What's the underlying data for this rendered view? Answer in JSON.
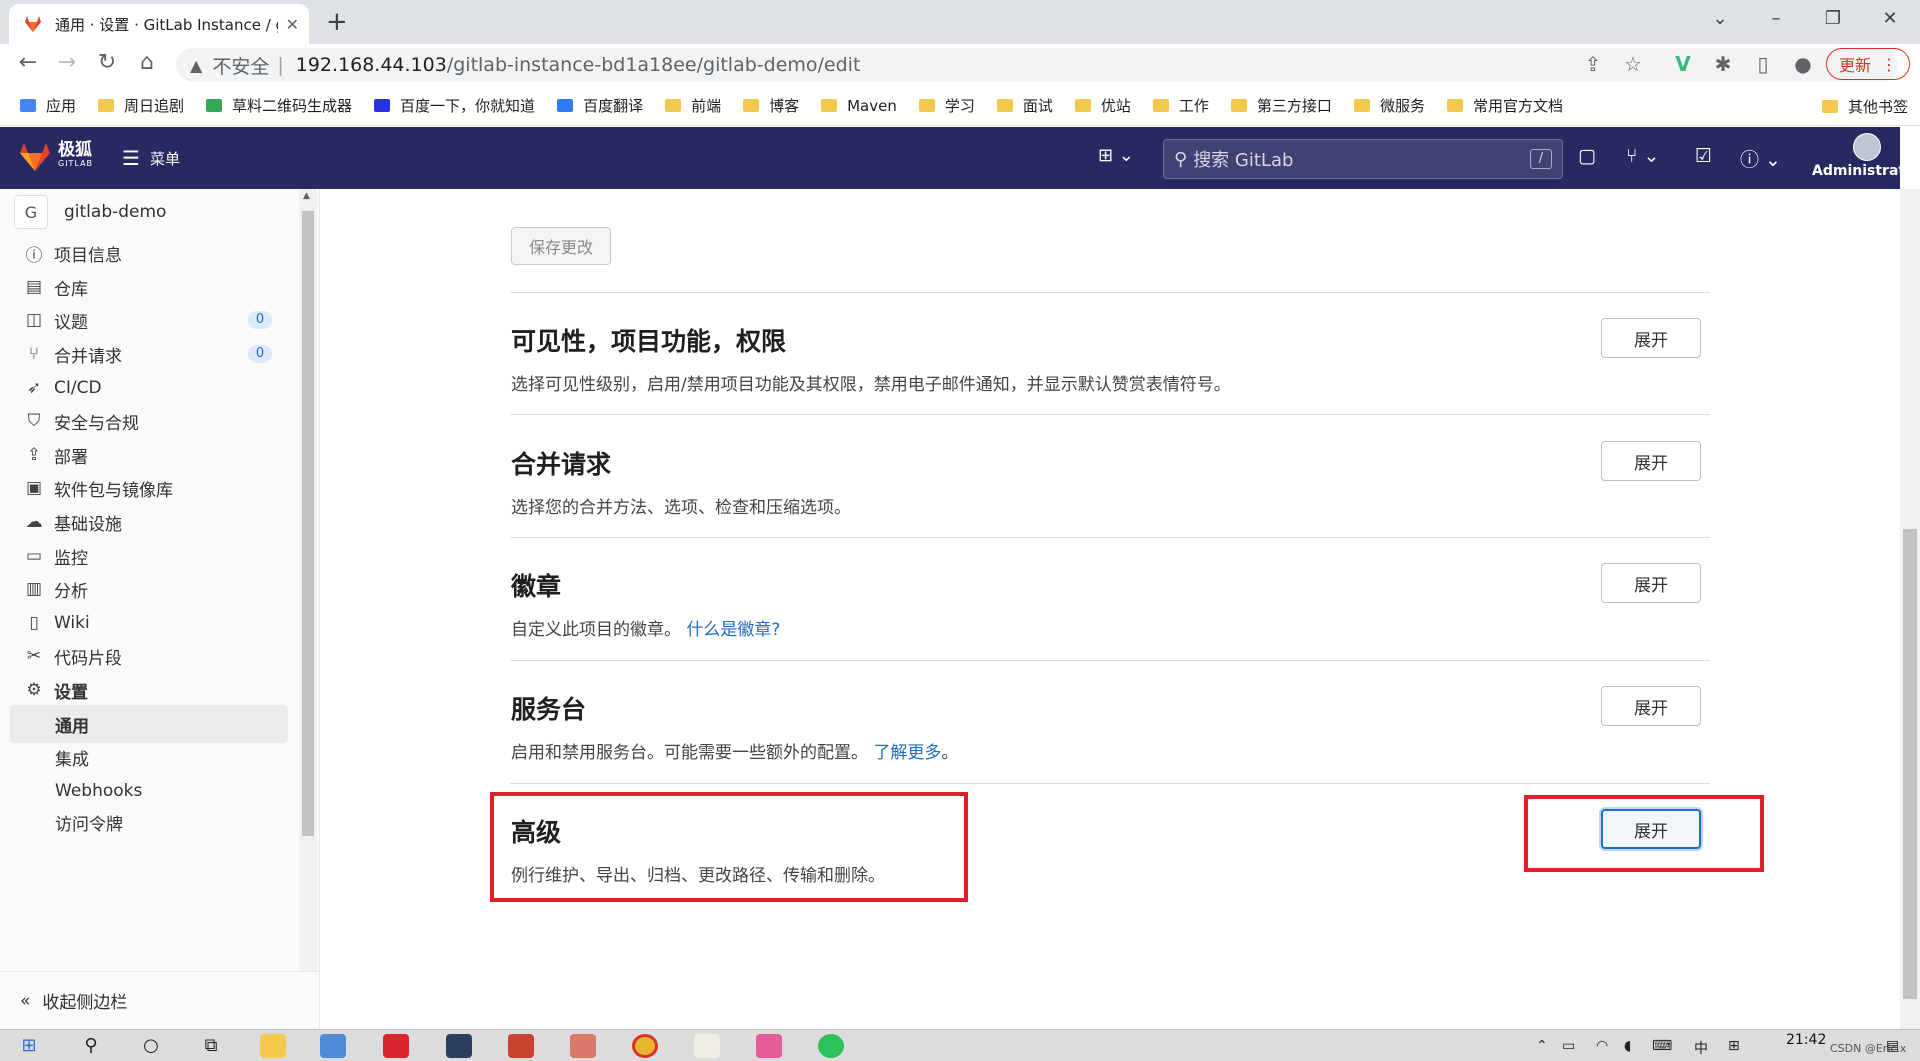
{
  "browser": {
    "tab_title": "通用 · 设置 · GitLab Instance / g",
    "tab_close": "✕",
    "new_tab": "+",
    "address_warning": "不安全",
    "address_host": "192.168.44.103",
    "address_path": "/gitlab-instance-bd1a18ee/gitlab-demo/edit",
    "update_label": "更新"
  },
  "bookmarks": [
    {
      "label": "应用",
      "icon": "apps-grid-icon"
    },
    {
      "label": "周日追剧",
      "icon": "folder-icon"
    },
    {
      "label": "草料二维码生成器",
      "icon": "qr-icon"
    },
    {
      "label": "百度一下，你就知道",
      "icon": "baidu-icon"
    },
    {
      "label": "百度翻译",
      "icon": "translate-icon"
    },
    {
      "label": "前端",
      "icon": "folder-icon"
    },
    {
      "label": "博客",
      "icon": "folder-icon"
    },
    {
      "label": "Maven",
      "icon": "folder-icon"
    },
    {
      "label": "学习",
      "icon": "folder-icon"
    },
    {
      "label": "面试",
      "icon": "folder-icon"
    },
    {
      "label": "优站",
      "icon": "folder-icon"
    },
    {
      "label": "工作",
      "icon": "folder-icon"
    },
    {
      "label": "第三方接口",
      "icon": "folder-icon"
    },
    {
      "label": "微服务",
      "icon": "folder-icon"
    },
    {
      "label": "常用官方文档",
      "icon": "folder-icon"
    }
  ],
  "bookmarks_other": "其他书签",
  "gitlab": {
    "brand_main": "极狐",
    "brand_sub": "GITLAB",
    "menu_label": "菜单",
    "search_placeholder": "搜索 GitLab",
    "search_shortcut": "/",
    "user_name": "Administrator"
  },
  "sidebar": {
    "project_initial": "G",
    "project_name": "gitlab-demo",
    "items": [
      {
        "label": "项目信息",
        "icon": "info-icon"
      },
      {
        "label": "仓库",
        "icon": "document-icon"
      },
      {
        "label": "议题",
        "icon": "issues-icon",
        "badge": "0"
      },
      {
        "label": "合并请求",
        "icon": "merge-request-icon",
        "badge": "0"
      },
      {
        "label": "CI/CD",
        "icon": "rocket-icon"
      },
      {
        "label": "安全与合规",
        "icon": "shield-icon"
      },
      {
        "label": "部署",
        "icon": "deploy-icon"
      },
      {
        "label": "软件包与镜像库",
        "icon": "package-icon"
      },
      {
        "label": "基础设施",
        "icon": "cloud-icon"
      },
      {
        "label": "监控",
        "icon": "monitor-icon"
      },
      {
        "label": "分析",
        "icon": "chart-icon"
      },
      {
        "label": "Wiki",
        "icon": "book-icon"
      },
      {
        "label": "代码片段",
        "icon": "scissors-icon"
      },
      {
        "label": "设置",
        "icon": "settings-icon"
      }
    ],
    "sub_items": [
      {
        "label": "通用",
        "active": true
      },
      {
        "label": "集成"
      },
      {
        "label": "Webhooks"
      },
      {
        "label": "访问令牌"
      }
    ],
    "collapse_label": "收起侧边栏"
  },
  "main": {
    "save_button": "保存更改",
    "expand_label": "展开",
    "sections": [
      {
        "title": "可见性，项目功能，权限",
        "desc": "选择可见性级别，启用/禁用项目功能及其权限，禁用电子邮件通知，并显示默认赞赏表情符号。"
      },
      {
        "title": "合并请求",
        "desc": "选择您的合并方法、选项、检查和压缩选项。"
      },
      {
        "title": "徽章",
        "desc": "自定义此项目的徽章。",
        "link": "什么是徽章?"
      },
      {
        "title": "服务台",
        "desc": "启用和禁用服务台。可能需要一些额外的配置。",
        "link": "了解更多",
        "suffix": "。"
      },
      {
        "title": "高级",
        "desc": "例行维护、导出、归档、更改路径、传输和删除。"
      }
    ]
  },
  "taskbar": {
    "time": "21:42",
    "ime": "中",
    "watermark": "CSDN @Eric.x"
  },
  "colors": {
    "header_bg": "#292961",
    "highlight_red": "#e01e2a",
    "link_blue": "#1f6dc4"
  }
}
